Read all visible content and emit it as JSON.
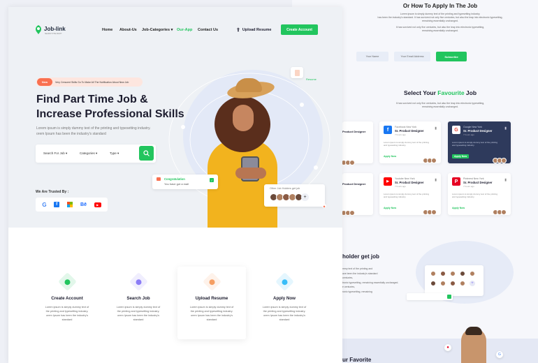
{
  "brand": {
    "name": "Job-link",
    "tagline": "SEARCH THE RIGHT"
  },
  "nav": {
    "home": "Home",
    "about": "About-Us",
    "categories": "Job-Categories",
    "app": "Our-App",
    "contact": "Contact Us",
    "upload": "Upload Resume",
    "create": "Create Account"
  },
  "hero": {
    "badge": "New",
    "notice": "Very Crescent Skills Go To Make All The Notification About New Job",
    "title_line1": "Find Part Time Job &",
    "title_line2": "Increase Professional Skills",
    "desc_line1": "Lorem ipsum is simply dummy text of the printing and typesetting industry.",
    "desc_line2": "orem Ipsum has been the industry's standard",
    "search_label": "Search For Job",
    "categories_label": "Categories",
    "type_label": "Type",
    "trusted": "We Are Trusted By :",
    "resume_tag": "Resume",
    "congrats_title": "Congratulation",
    "congrats_sub": "You have got a mail",
    "other_jobs": "Other Job Holders get job"
  },
  "steps": [
    {
      "title": "Create Account",
      "desc": "Lorem ipsum is simply dummy text of the printing and typesetting industry. orem Ipsum has been the industry's standard",
      "color": "#22c55e"
    },
    {
      "title": "Search Job",
      "desc": "Lorem ipsum is simply dummy text of the printing and typesetting industry. orem Ipsum has been the industry's standard",
      "color": "#8b7cf6"
    },
    {
      "title": "Upload Resume",
      "desc": "Lorem ipsum is simply dummy text of the printing and typesetting industry. orem Ipsum has been the industry's standard",
      "color": "#f59e62"
    },
    {
      "title": "Apply Now",
      "desc": "Lorem ipsum is simply dummy text of the printing and typesetting industry. orem Ipsum has been the industry's standard",
      "color": "#38bdf8"
    }
  ],
  "back": {
    "how_title": "Or How To Apply In The Job",
    "how_desc1": "Lorem ipsum is simply dummy text of the printing and typesetting industry.",
    "how_desc2": "has been the industry's standard. It has survived not only five centuries, but also the leap into electronic typesetting,",
    "how_desc3": "remaining essentially unchanged.",
    "how_desc4": "It has survived not only five centuries, but also the leap into electronic typesetting,",
    "how_desc5": "remaining essentially unchanged.",
    "name_placeholder": "Your Name",
    "email_placeholder": "Your Email Address",
    "subscribe": "Subscribe",
    "fav_title_a": "Select Your ",
    "fav_title_b": "Favourite",
    "fav_title_c": " Job",
    "fav_desc1": "It has survived not only five centuries, but also the leap into electronic typesetting,",
    "fav_desc2": "remaining essentially unchanged.",
    "jobs": [
      {
        "company": "Facebook New York",
        "role": "Sr. Product Designer",
        "time": "7 hours ago",
        "logo": "f",
        "logo_color": "#1877f2",
        "dark": false
      },
      {
        "company": "Google New York",
        "role": "Sr. Product Designer",
        "time": "7 hours ago",
        "logo": "G",
        "logo_color": "#ea4335",
        "dark": true
      },
      {
        "company": "Youtube New York",
        "role": "Sr. Product Designer",
        "time": "7 hours ago",
        "logo": "▶",
        "logo_color": "#ff0000",
        "dark": false
      },
      {
        "company": "Pinterest New York",
        "role": "Sr. Product Designer",
        "time": "7 hours ago",
        "logo": "P",
        "logo_color": "#e60023",
        "dark": false
      }
    ],
    "partial_role": "Product Designer",
    "apply": "Apply Now",
    "card_desc": "Lorem ipsum is simply dummy text of the printing and typesetting industry.",
    "holder_title": "holder get job",
    "holder_lines": [
      "mmy text of the printing and",
      "ave been the industry's standard",
      "centuries,",
      "tronic typesetting, remaining essentially unchanged.",
      "e centuries,",
      "ronic typesetting, remaining"
    ],
    "bottom_title": "ur Favorite"
  }
}
